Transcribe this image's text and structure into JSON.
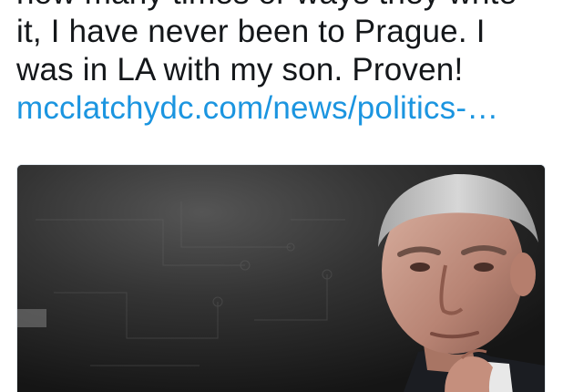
{
  "tweet": {
    "text_lines": [
      "how many times or ways they write",
      "it, I have never been to Prague. I",
      "was in LA with my son. Proven!"
    ],
    "link_text": "mcclatchydc.com/news/politics-…"
  },
  "media": {
    "description_icon": "photo-of-man-thinking"
  },
  "colors": {
    "text": "#14171a",
    "link": "#1b95e0",
    "card_border": "#e1e8ed"
  }
}
